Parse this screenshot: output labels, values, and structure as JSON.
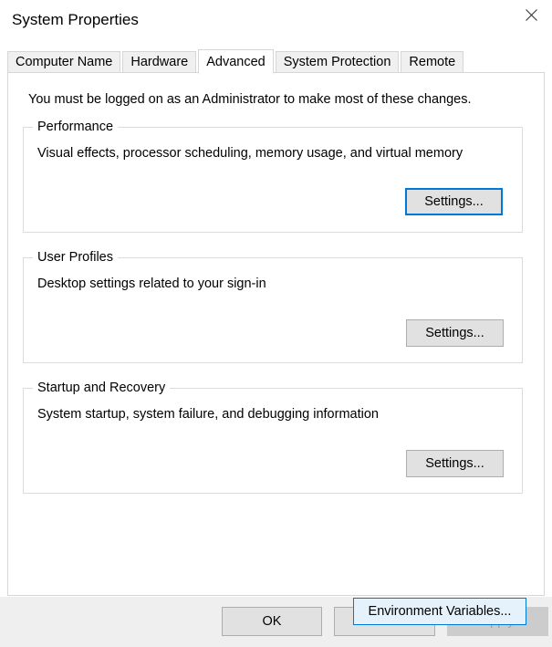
{
  "window": {
    "title": "System Properties",
    "close_icon": "close-icon"
  },
  "tabs": [
    {
      "label": "Computer Name",
      "selected": false
    },
    {
      "label": "Hardware",
      "selected": false
    },
    {
      "label": "Advanced",
      "selected": true
    },
    {
      "label": "System Protection",
      "selected": false
    },
    {
      "label": "Remote",
      "selected": false
    }
  ],
  "panel": {
    "intro": "You must be logged on as an Administrator to make most of these changes.",
    "groups": [
      {
        "title": "Performance",
        "description": "Visual effects, processor scheduling, memory usage, and virtual memory",
        "button_label": "Settings..."
      },
      {
        "title": "User Profiles",
        "description": "Desktop settings related to your sign-in",
        "button_label": "Settings..."
      },
      {
        "title": "Startup and Recovery",
        "description": "System startup, system failure, and debugging information",
        "button_label": "Settings..."
      }
    ],
    "environment_variables_label": "Environment Variables..."
  },
  "footer": {
    "ok_label": "OK",
    "cancel_label": "Cancel",
    "apply_label": "Apply"
  },
  "colors": {
    "accent": "#0078d7",
    "button_face": "#e1e1e1",
    "button_border": "#adadad",
    "disabled_face": "#cccccc",
    "disabled_text": "#a0a0a0",
    "footer_bg": "#efefef",
    "group_border": "#dcdcdc",
    "tab_bg": "#f0f0f0",
    "tab_border": "#d6d6d6"
  }
}
